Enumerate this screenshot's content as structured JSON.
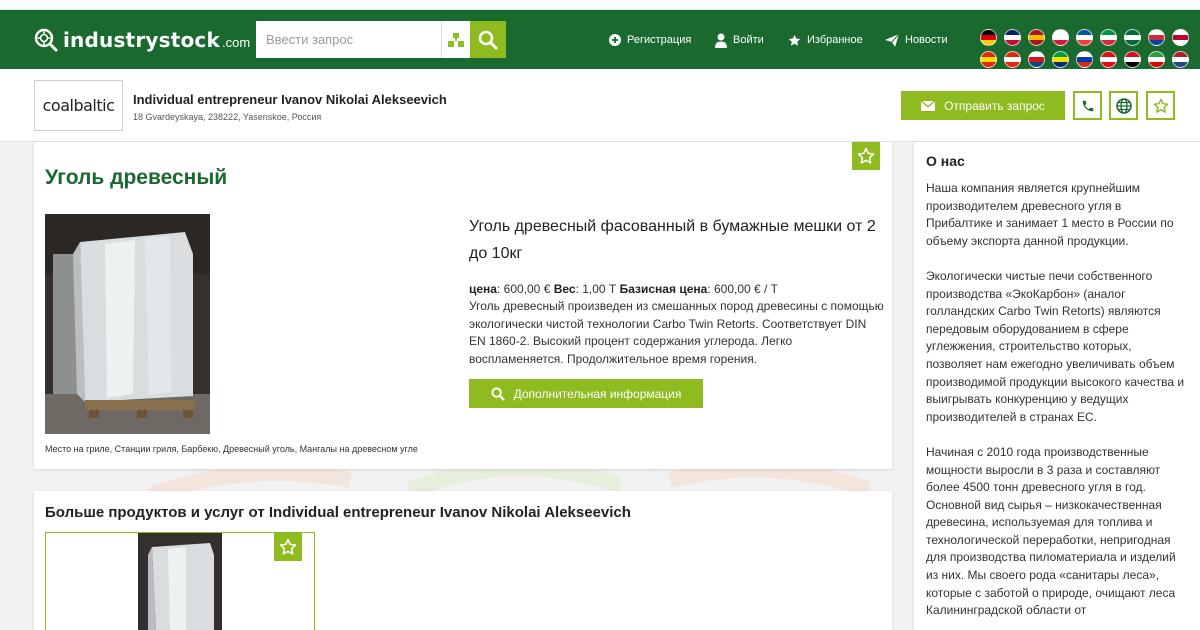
{
  "site": {
    "logo_main": "industrystock",
    "logo_domain": ".com",
    "search_placeholder": "Ввести запрос",
    "nav": [
      {
        "label": "Регистрация",
        "icon": "plus-circle-icon"
      },
      {
        "label": "Войти",
        "icon": "user-icon"
      },
      {
        "label": "Избранное",
        "icon": "star-icon"
      },
      {
        "label": "Новости",
        "icon": "paper-plane-icon"
      }
    ],
    "flags": [
      {
        "code": "de",
        "colors": [
          "#000000",
          "#dd0000",
          "#ffce00"
        ]
      },
      {
        "code": "gb",
        "colors": [
          "#012169",
          "#ffffff",
          "#c8102e"
        ]
      },
      {
        "code": "es",
        "colors": [
          "#aa151b",
          "#f1bf00",
          "#aa151b"
        ]
      },
      {
        "code": "pl",
        "colors": [
          "#ffffff",
          "#ffffff",
          "#dc143c"
        ]
      },
      {
        "code": "fr",
        "colors": [
          "#0055a4",
          "#ffffff",
          "#ef4135"
        ]
      },
      {
        "code": "it",
        "colors": [
          "#009246",
          "#ffffff",
          "#ce2b37"
        ]
      },
      {
        "code": "sa",
        "colors": [
          "#006c35",
          "#ffffff",
          "#006c35"
        ]
      },
      {
        "code": "kr",
        "colors": [
          "#ffffff",
          "#cd2e3a",
          "#0047a0"
        ]
      },
      {
        "code": "jp",
        "colors": [
          "#ffffff",
          "#bc002d",
          "#ffffff"
        ]
      },
      {
        "code": "cn",
        "colors": [
          "#de2910",
          "#ffde00",
          "#de2910"
        ]
      },
      {
        "code": "hk",
        "colors": [
          "#de2910",
          "#ffffff",
          "#de2910"
        ]
      },
      {
        "code": "cz",
        "colors": [
          "#ffffff",
          "#d7141a",
          "#11457e"
        ]
      },
      {
        "code": "br",
        "colors": [
          "#009c3b",
          "#ffdf00",
          "#002776"
        ]
      },
      {
        "code": "ru",
        "colors": [
          "#ffffff",
          "#0039a6",
          "#d52b1e"
        ]
      },
      {
        "code": "tr",
        "colors": [
          "#e30a17",
          "#ffffff",
          "#e30a17"
        ]
      },
      {
        "code": "eg",
        "colors": [
          "#ce1126",
          "#ffffff",
          "#000000"
        ]
      },
      {
        "code": "ir",
        "colors": [
          "#239f40",
          "#ffffff",
          "#da0000"
        ]
      },
      {
        "code": "nl",
        "colors": [
          "#ae1c28",
          "#ffffff",
          "#21468b"
        ]
      }
    ]
  },
  "company": {
    "logo_text": "coalbaltic",
    "name": "Individual entrepreneur Ivanov Nikolai Alekseevich",
    "address": "18 Gvardeyskaya, 238222, Yasenskoe, Россия",
    "request_label": "Отправить запрос"
  },
  "product": {
    "title": "Уголь древесный",
    "headline": "Уголь древесный фасованный в бумажные мешки от 2 до 10кг",
    "price_label": "цена",
    "price_value": "600,00 € ",
    "weight_label": "Вес",
    "weight_value": "1,00 Т ",
    "base_price_label": "Базисная цена",
    "base_price_value": "600,00 € / Т",
    "description": "Уголь древесный произведен из смешанных пород древесины с помощью экологически чистой технологии Carbo Twin Retorts. Соответствует DIN EN 1860-2. Высокий процент содержания углерода. Легко воспламеняется. Продолжительное время горения.",
    "more_info_label": "Дополнительная информация",
    "tags": "Место на гриле, Станции гриля, Барбекю, Древесный уголь, Мангалы на древесном угле"
  },
  "more_products": {
    "title": "Больше продуктов и услуг от Individual entrepreneur Ivanov Nikolai Alekseevich"
  },
  "about": {
    "title": "О нас",
    "paragraphs": [
      "Наша компания является крупнейшим производителем древесного угля в Прибалтике и занимает 1 место в России по объему экспорта данной продукции.",
      "Экологически чистые печи собственного производства «ЭкоКарбон» (аналог голландских Carbo Twin Retorts) являются передовым оборудованием в сфере углежжения, строительство которых, позволяет нам ежегодно увеличивать объем производимой продукции высокого качества и выигрывать конкуренцию у ведущих производителей в странах ЕС.",
      "Начиная с 2010 года производственные мощности выросли в 3 раза и составляют более 4500 тонн древесного угля в год. Основной вид сырья – низкокачественная древесина, используемая для топлива и технологической переработки, непригодная для производства пиломатериала и изделий из них. Мы своего рода «санитары леса», которые с заботой о природе, очищают леса Калининградской области от"
    ]
  },
  "colors": {
    "header_green": "#1a6a2f",
    "accent_lime": "#8dbb20",
    "title_green": "#1a6a2f"
  }
}
